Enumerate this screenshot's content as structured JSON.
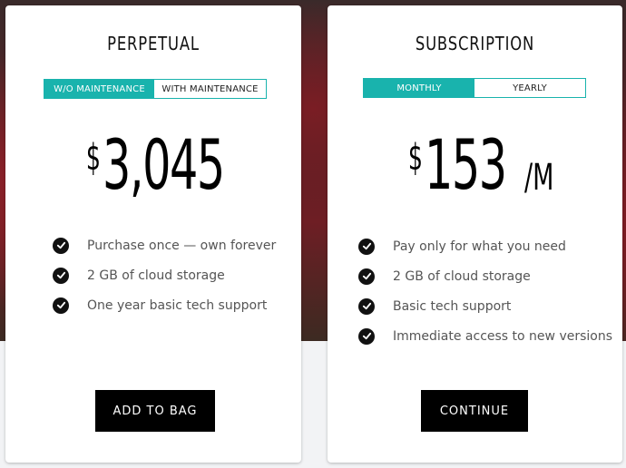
{
  "perpetual": {
    "title": "PERPETUAL",
    "toggle": {
      "option_1": "W/O MAINTENANCE",
      "option_2": "WITH MAINTENANCE",
      "selected": "W/O MAINTENANCE"
    },
    "price": {
      "currency": "$",
      "amount": "3,045"
    },
    "features": [
      "Purchase once — own forever",
      "2 GB of cloud storage",
      "One year basic tech support"
    ],
    "cta_label": "ADD TO BAG"
  },
  "subscription": {
    "title": "SUBSCRIPTION",
    "toggle": {
      "option_1": "MONTHLY",
      "option_2": "YEARLY",
      "selected": "MONTHLY"
    },
    "price": {
      "currency": "$",
      "amount": "153",
      "period": "/M"
    },
    "features": [
      "Pay only for what you need",
      "2 GB of cloud storage",
      "Basic tech support",
      "Immediate access to new versions"
    ],
    "cta_label": "CONTINUE"
  },
  "colors": {
    "accent": "#19b3ad",
    "button": "#000000",
    "card": "#ffffff",
    "background_band": "#6e1e24"
  },
  "icons": {
    "feature_check": "check-circle-icon"
  }
}
